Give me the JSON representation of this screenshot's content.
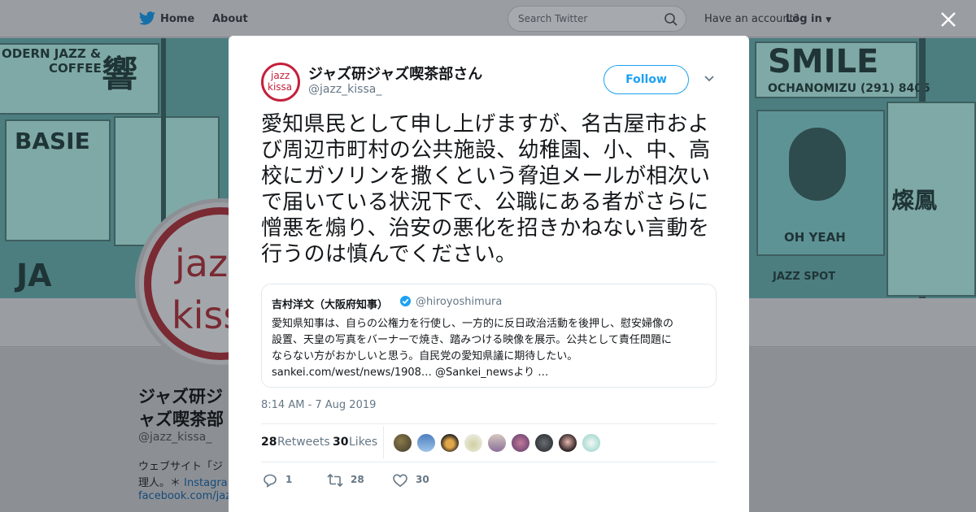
{
  "nav": {
    "home_label": "Home",
    "about_label": "About",
    "search_placeholder": "Search Twitter",
    "have_account": "Have an account?",
    "login_label": "Log in"
  },
  "profile": {
    "name": "ジャズ研ジャズ喫茶部さん",
    "handle": "@jazz_kissa_",
    "avatar_line1": "jazz",
    "avatar_line2": "kissa",
    "bio_line1": "ウェブサイト「ジ",
    "bio_line2_prefix": "理人。＊",
    "bio_line2_link": "Instagra",
    "bio_line3": "facebook.com/jazz"
  },
  "banner": {
    "text_modern_jazz": "ODERN JAZZ &",
    "text_coffee": "COFFEE",
    "text_kyo": "響",
    "text_basie": "BASIE",
    "text_smile": "SMILE",
    "text_ochanomizu": "OCHANOMIZU (291) 8405",
    "text_oh_yeah": "OH YEAH",
    "text_jazz_spot": "JAZZ SPOT",
    "text_kanji_right": "燦鳳",
    "text_ja": "JA"
  },
  "tweet": {
    "avatar_line1": "jazz",
    "avatar_line2": "kissa",
    "author_name": "ジャズ研ジャズ喫茶部さん",
    "author_handle": "@jazz_kissa_",
    "follow_label": "Follow",
    "text": "愛知県民として申し上げますが、名古屋市および周辺市町村の公共施設、幼稚園、小、中、高校にガソリンを撒くという脅迫メールが相次いで届いている状況下で、公職にある者がさらに憎悪を煽り、治安の悪化を招きかねない言動を行うのは慎んでください。",
    "quote": {
      "name": "吉村洋文（大阪府知事）",
      "handle": "@hiroyoshimura",
      "line1": "愛知県知事は、自らの公権力を行使し、一方的に反日政治活動を後押し、慰安婦像の",
      "line2": "設置、天皇の写真をバーナーで焼き、踏みつける映像を展示。公共として責任問題に",
      "line3": "ならない方がおかしいと思う。自民党の愛知県議に期待したい。",
      "line4": "sankei.com/west/news/1908… @Sankei_newsより …"
    },
    "timestamp": "8:14 AM - 7 Aug 2019",
    "retweets_count": "28",
    "retweets_label": "Retweets",
    "likes_count": "30",
    "likes_label": "Likes",
    "actions": {
      "reply_count": "1",
      "retweet_count": "28",
      "like_count": "30"
    }
  },
  "colors": {
    "brand_blue": "#1da1f2",
    "avatar_red": "#c4213b",
    "banner_teal": "#4c7e80",
    "overlay_gray": "#8f9398"
  }
}
